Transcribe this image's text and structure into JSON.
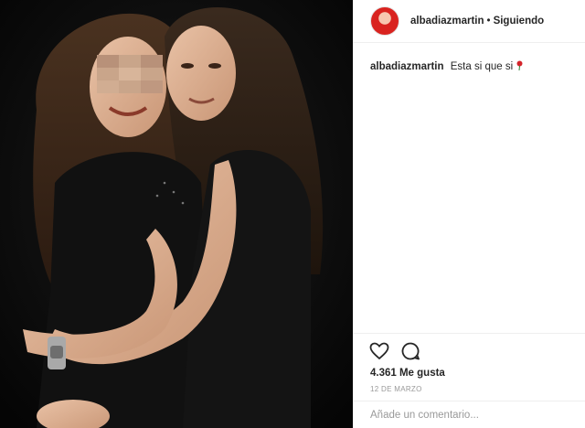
{
  "post": {
    "username": "albadiazmartin",
    "separator": "•",
    "follow_status": "Siguiendo",
    "caption_text": "Esta si que si",
    "likes_text": "4.361 Me gusta",
    "date_text": "12 DE MARZO",
    "comment_placeholder": "Añade un comentario..."
  },
  "icons": {
    "like": "heart-icon",
    "comment": "comment-bubble-icon",
    "caption_emoji": "rose-icon"
  },
  "colors": {
    "photo_background": "#0b0b0b",
    "avatar_accent": "#d9231f",
    "text": "#262626",
    "muted": "#999999",
    "divider": "#efefef"
  }
}
